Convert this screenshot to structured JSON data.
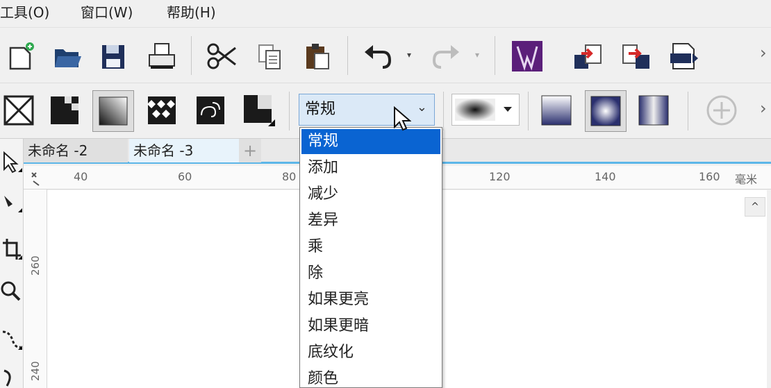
{
  "menu": [
    {
      "label": "工具(O)"
    },
    {
      "label": "窗口(W)"
    },
    {
      "label": "帮助(H)"
    }
  ],
  "blend": {
    "current": "常规",
    "options": [
      "常规",
      "添加",
      "减少",
      "差异",
      "乘",
      "除",
      "如果更亮",
      "如果更暗",
      "底纹化",
      "颜色"
    ],
    "selected_index": 0
  },
  "tabs": [
    {
      "label": "未命名 -2",
      "active": false
    },
    {
      "label": "未命名 -3",
      "active": true
    }
  ],
  "ruler": {
    "h_labels": [
      "40",
      "60",
      "80",
      "120",
      "140",
      "160"
    ],
    "unit": "毫米",
    "v_labels": [
      "260",
      "240"
    ]
  },
  "colors": {
    "accent": "#0a64d2",
    "tab_underline": "#5cb6e8",
    "combo_bg": "#dbe9f7"
  },
  "icons": {
    "toolbar1": [
      "new-document-icon",
      "open-folder-icon",
      "save-icon",
      "print-icon",
      "cut-icon",
      "copy-icon",
      "paste-icon",
      "undo-icon",
      "redo-icon",
      "app-launcher-icon",
      "import-icon",
      "export-icon",
      "export-pdf-icon"
    ],
    "toolbar2": [
      "no-transparency-icon",
      "uniform-transparency-icon",
      "fountain-transparency-icon",
      "vector-pattern-transparency-icon",
      "bitmap-pattern-transparency-icon",
      "two-color-pattern-icon"
    ]
  }
}
